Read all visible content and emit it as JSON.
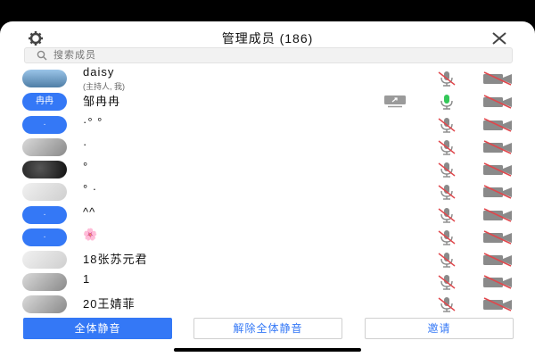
{
  "header": {
    "title": "管理成员 (186)"
  },
  "search": {
    "placeholder": "搜索成员"
  },
  "members": [
    {
      "name": "daisy",
      "subtitle": "(主持人, 我)",
      "avatar": "sky"
    },
    {
      "name": "邹冉冉",
      "avatar_text": "冉冉",
      "avatar": "blue",
      "sharing": true,
      "mic_active": true
    },
    {
      "name": "·° °",
      "avatar_text": "·",
      "avatar": "blue"
    },
    {
      "name": "·",
      "avatar": "photo"
    },
    {
      "name": "°",
      "avatar": "dark"
    },
    {
      "name": "° ·",
      "avatar": "light"
    },
    {
      "name": "^^ ",
      "avatar_text": "·",
      "avatar": "blue"
    },
    {
      "name": "🌸",
      "avatar_text": "·",
      "avatar": "blue"
    },
    {
      "name": "18张苏元君",
      "avatar": "light"
    },
    {
      "name": "1",
      "avatar": "photo"
    },
    {
      "name": "20王婧菲",
      "avatar": "photo"
    }
  ],
  "footer": {
    "mute_all": "全体静音",
    "unmute_all": "解除全体静音",
    "invite": "邀请"
  },
  "colors": {
    "accent": "#3478f6",
    "muted_red": "#e0474c",
    "mic_green": "#34c759"
  }
}
